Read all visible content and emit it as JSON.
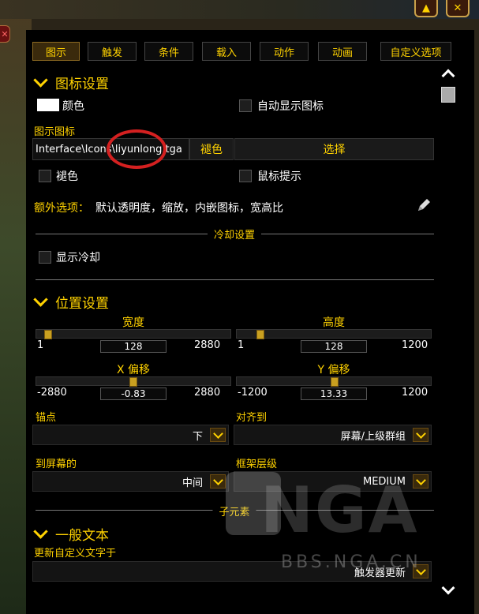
{
  "tabs": [
    "图示",
    "触发",
    "条件",
    "载入",
    "动作",
    "动画",
    "自定义选项"
  ],
  "icon_settings": {
    "heading": "图标设置",
    "color_label": "颜色",
    "auto_show_label": "自动显示图标",
    "display_icon_label": "图示图标",
    "icon_path": "Interface\\Icons\\liyunlong.tga",
    "desaturate_button": "褪色",
    "choose_button": "选择",
    "desaturate_label": "褪色",
    "tooltip_label": "鼠标提示",
    "extra_options_label": "额外选项：",
    "extra_options_value": "默认透明度，缩放，内嵌图标，宽高比",
    "cooldown_divider": "冷却设置",
    "show_cooldown_label": "显示冷却"
  },
  "position_settings": {
    "heading": "位置设置",
    "width": {
      "title": "宽度",
      "min": "1",
      "max": "2880",
      "value": "128",
      "fraction": 0.044
    },
    "height": {
      "title": "高度",
      "min": "1",
      "max": "1200",
      "value": "128",
      "fraction": 0.106
    },
    "x_offset": {
      "title": "X 偏移",
      "min": "-2880",
      "max": "2880",
      "value": "-0.83",
      "fraction": 0.5
    },
    "y_offset": {
      "title": "Y 偏移",
      "min": "-1200",
      "max": "1200",
      "value": "13.33",
      "fraction": 0.506
    },
    "anchor_label": "锚点",
    "anchor_value": "下",
    "align_label": "对齐到",
    "align_value": "屏幕/上级群组",
    "to_screen_label": "到屏幕的",
    "to_screen_value": "中间",
    "strata_label": "框架层级",
    "strata_value": "MEDIUM"
  },
  "sub_elements_divider": "子元素",
  "general_text": {
    "heading": "一般文本",
    "update_label": "更新自定义文字于",
    "update_value": "触发器更新"
  },
  "watermark": {
    "brand": "NGA",
    "url": "BBS.NGA.CN"
  }
}
